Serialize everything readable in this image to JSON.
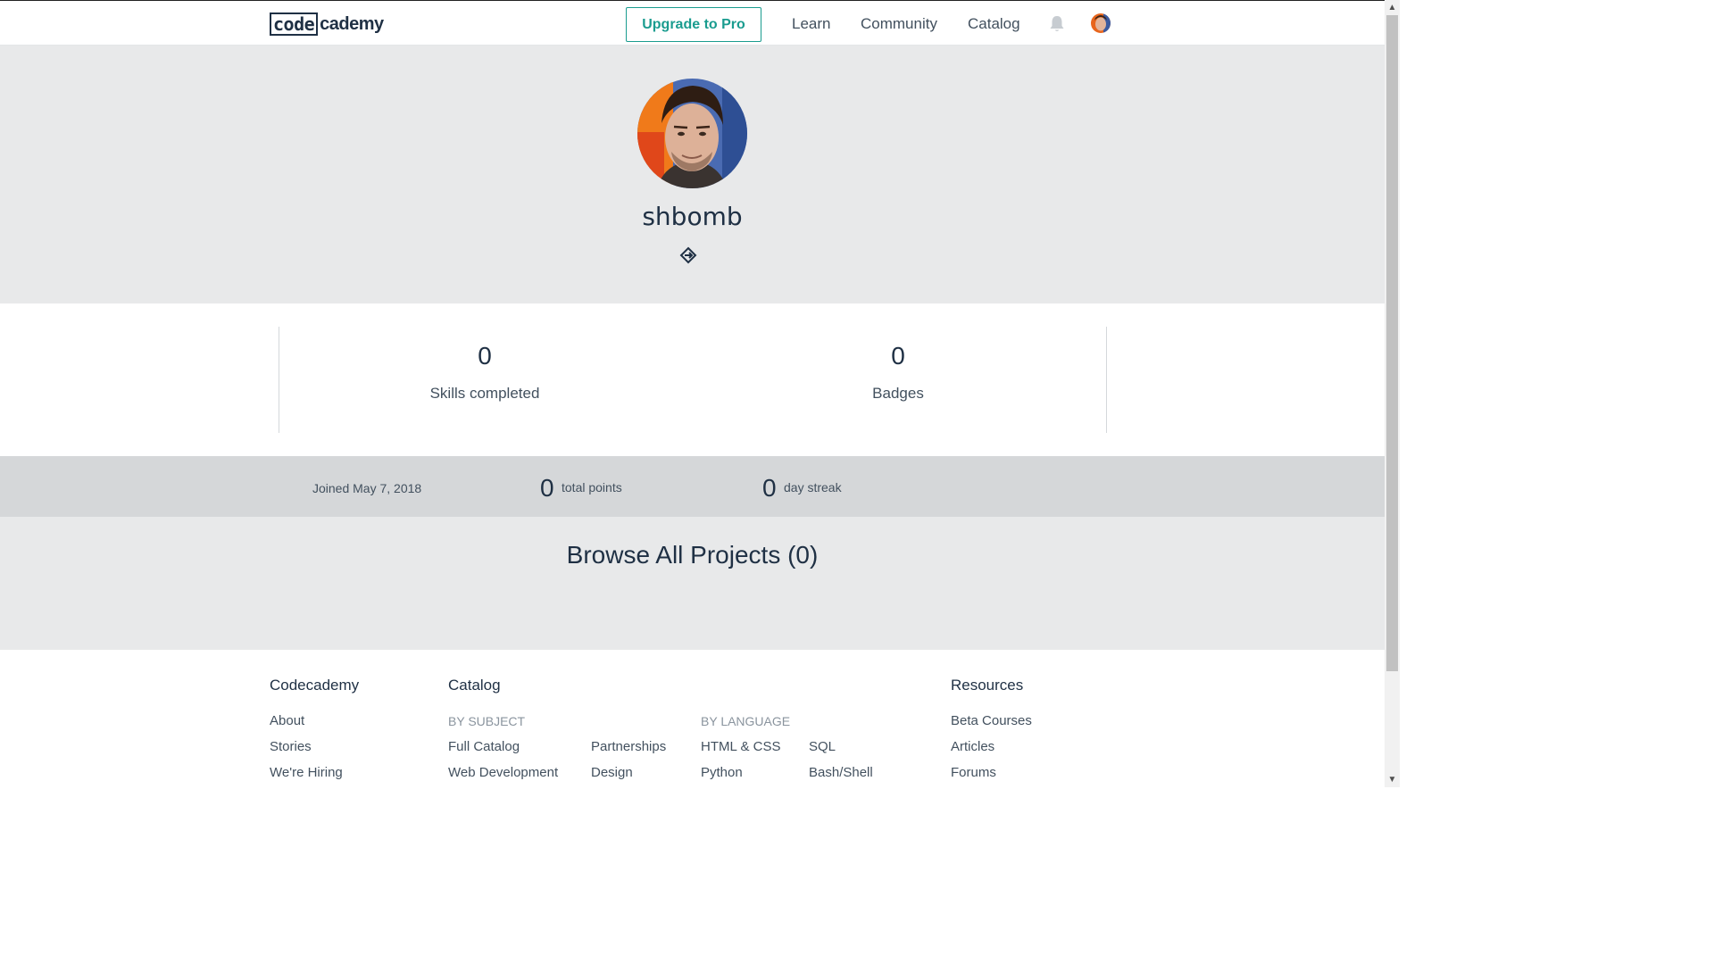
{
  "header": {
    "logo_boxed": "code",
    "logo_rest": "cademy",
    "upgrade_label": "Upgrade to Pro",
    "nav": [
      "Learn",
      "Community",
      "Catalog"
    ],
    "bell_icon": "bell-icon",
    "avatar_icon": "user-avatar"
  },
  "profile": {
    "username": "shbomb",
    "link_icon": "link-icon"
  },
  "stats": {
    "skills_value": "0",
    "skills_label": "Skills completed",
    "badges_value": "0",
    "badges_label": "Badges"
  },
  "info": {
    "joined": "Joined May 7, 2018",
    "points_value": "0",
    "points_label": "total points",
    "streak_value": "0",
    "streak_label": "day streak"
  },
  "projects": {
    "browse_label": "Browse All Projects (0)"
  },
  "footer": {
    "codecademy": {
      "heading": "Codecademy",
      "links": [
        "About",
        "Stories",
        "We're Hiring"
      ]
    },
    "catalog": {
      "heading": "Catalog",
      "by_subject": "BY SUBJECT",
      "subject_col1": [
        "Full Catalog",
        "Web Development"
      ],
      "subject_col2": [
        "Partnerships",
        "Design"
      ],
      "by_language": "BY LANGUAGE",
      "language_col1": [
        "HTML & CSS",
        "Python"
      ],
      "language_col2": [
        "SQL",
        "Bash/Shell"
      ]
    },
    "resources": {
      "heading": "Resources",
      "links": [
        "Beta Courses",
        "Articles",
        "Forums"
      ]
    }
  },
  "colors": {
    "accent": "#1a9c8f",
    "text_dark": "#1f3044",
    "hero_bg": "#e8e9ea",
    "info_bg": "#d5d7d9"
  }
}
